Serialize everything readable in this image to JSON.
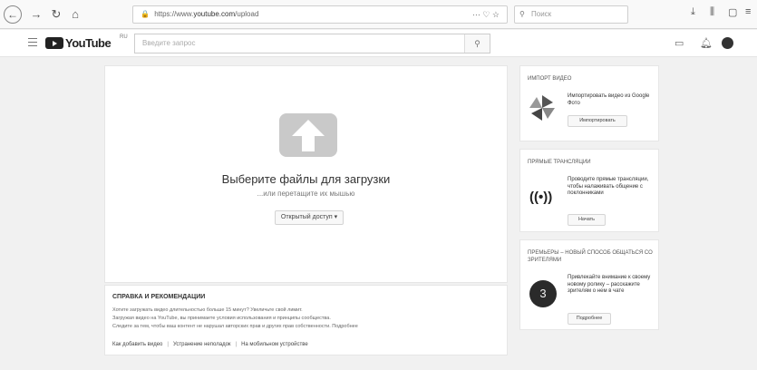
{
  "browser": {
    "url_prefix": "https://www.",
    "url_host": "youtube.com",
    "url_path": "/upload",
    "url_tools": "··· ♡ ☆",
    "search_placeholder": "Поиск"
  },
  "header": {
    "logo_text": "YouTube",
    "logo_region": "RU",
    "search_placeholder": "Введите запрос"
  },
  "upload": {
    "title": "Выберите файлы для загрузки",
    "subtitle": "...или перетащите их мышью",
    "privacy_button": "Открытый доступ ▾"
  },
  "help": {
    "title": "СПРАВКА И РЕКОМЕНДАЦИИ",
    "lines": [
      "Хотите загружать видео длительностью больше 15 минут? Увеличьте свой лимит.",
      "Загружая видео на YouTube, вы принимаете условия использования и принципы сообщества.",
      "Следите за тем, чтобы ваш контент не нарушал авторских прав и других прав собственности. Подробнее"
    ],
    "links": [
      "Как добавить видео",
      "Устранение неполадок",
      "На мобильном устройстве"
    ]
  },
  "import_card": {
    "title": "ИМПОРТ ВИДЕО",
    "text": "Импортировать видео из Google Фото",
    "button": "Импортировать"
  },
  "live_card": {
    "title": "ПРЯМЫЕ ТРАНСЛЯЦИИ",
    "text": "Проводите прямые трансляции, чтобы налаживать общение с поклонниками",
    "button": "Начать"
  },
  "premiere_card": {
    "title": "ПРЕМЬЕРЫ – НОВЫЙ СПОСОБ ОБЩАТЬСЯ СО ЗРИТЕЛЯМИ",
    "text": "Привлекайте внимание к своему новому ролику – расскажите зрителям о нем в чате",
    "button": "Подробнее",
    "icon_number": "3"
  }
}
